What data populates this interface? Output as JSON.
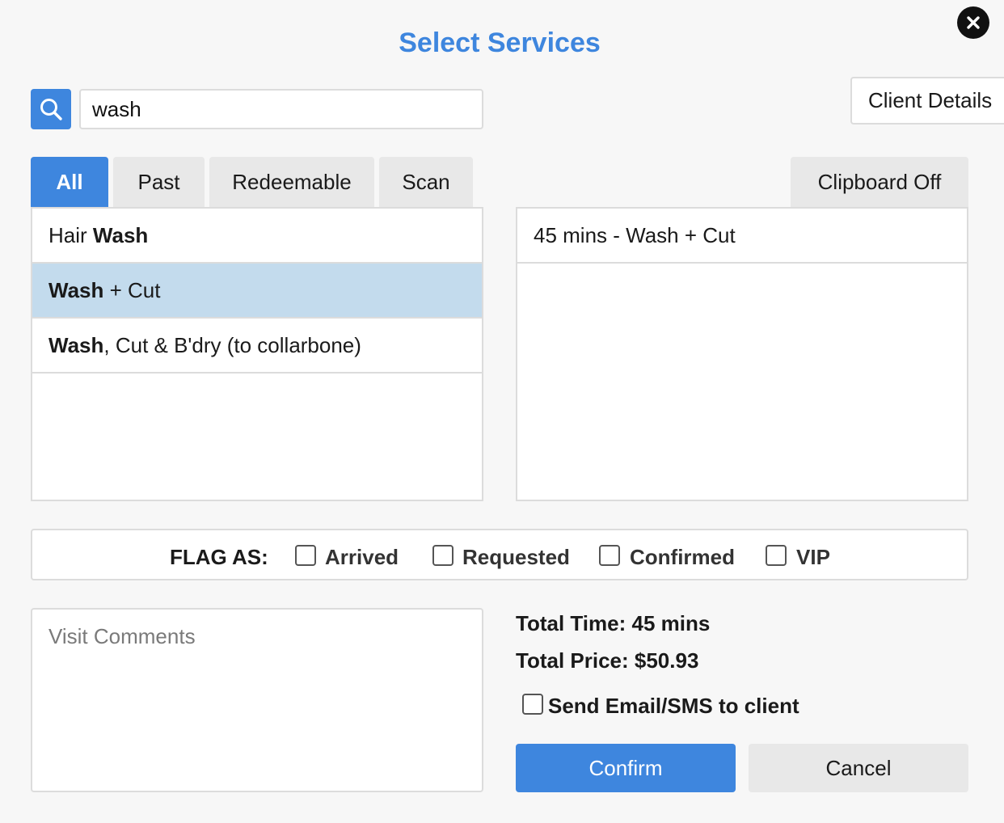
{
  "dialog": {
    "title": "Select Services",
    "close_icon": "close-icon"
  },
  "search": {
    "value": "wash",
    "icon": "search-icon"
  },
  "client_details_label": "Client Details",
  "tabs": [
    {
      "label": "All",
      "active": true
    },
    {
      "label": "Past",
      "active": false
    },
    {
      "label": "Redeemable",
      "active": false
    },
    {
      "label": "Scan",
      "active": false
    }
  ],
  "clipboard_label": "Clipboard Off",
  "services": [
    {
      "pre": "Hair ",
      "match": "Wash",
      "post": "",
      "selected": false
    },
    {
      "pre": "",
      "match": "Wash",
      "post": " + Cut",
      "selected": true
    },
    {
      "pre": "",
      "match": "Wash",
      "post": ", Cut & B'dry (to collarbone)",
      "selected": false
    }
  ],
  "selected_services": [
    {
      "label": "45 mins - Wash + Cut"
    }
  ],
  "flag_as": {
    "label": "FLAG AS:",
    "options": [
      {
        "label": "Arrived",
        "checked": false
      },
      {
        "label": "Requested",
        "checked": false
      },
      {
        "label": "Confirmed",
        "checked": false
      },
      {
        "label": "VIP",
        "checked": false
      }
    ]
  },
  "comments": {
    "placeholder": "Visit Comments",
    "value": ""
  },
  "totals": {
    "time": "Total Time: 45 mins",
    "price": "Total Price: $50.93"
  },
  "send_notification": {
    "label": "Send Email/SMS to client",
    "checked": false
  },
  "buttons": {
    "confirm": "Confirm",
    "cancel": "Cancel"
  },
  "colors": {
    "accent": "#3e86de",
    "selected_row": "#c3dbed",
    "background": "#f7f7f7"
  }
}
